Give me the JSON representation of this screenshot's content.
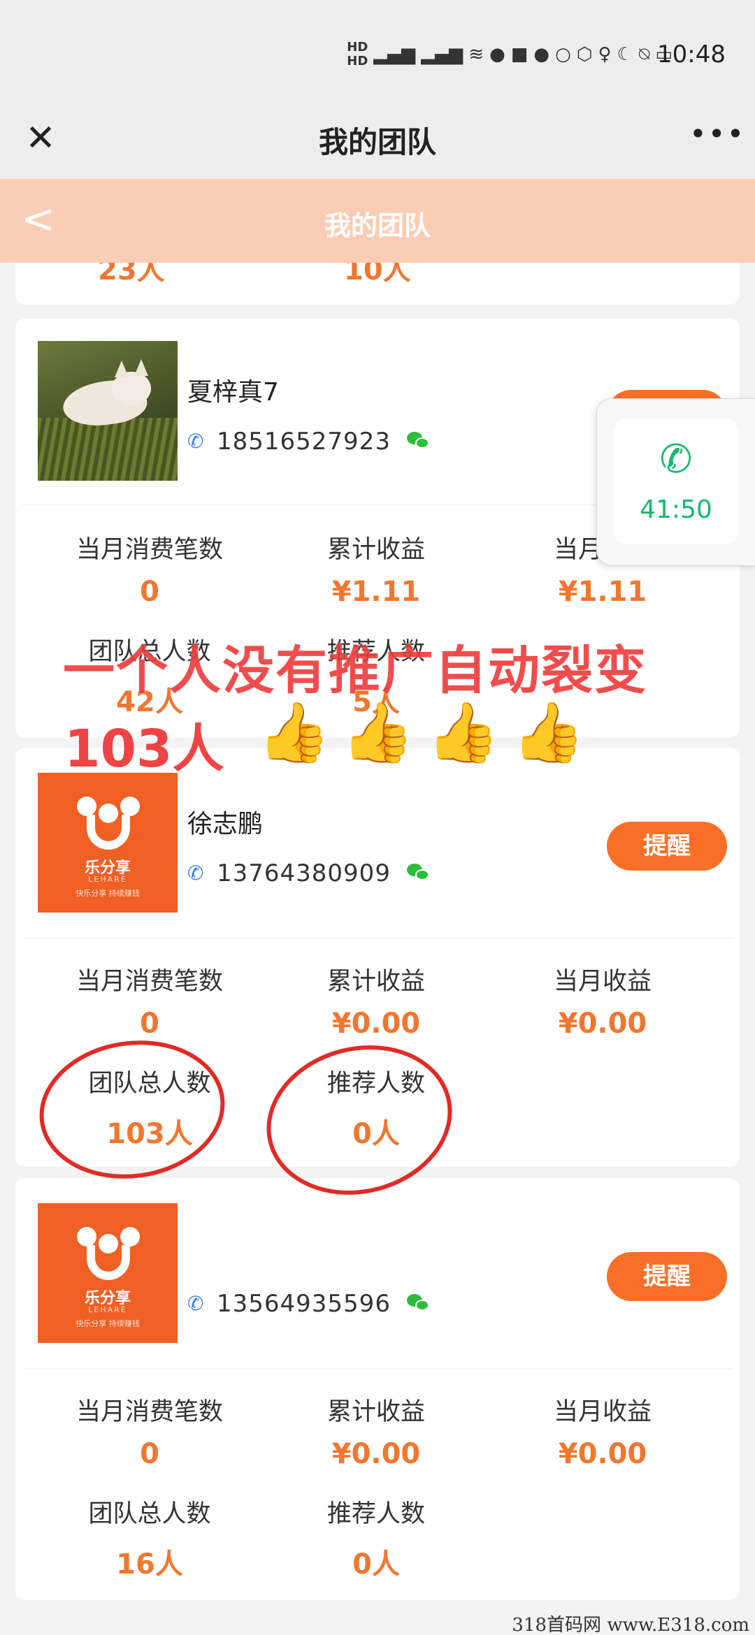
{
  "status_bar": {
    "time": "10:48",
    "indicators": [
      "HD",
      "5G",
      "4G",
      "wifi",
      "wechat",
      "huawei",
      "wechat",
      "chat",
      "shield",
      "mic",
      "moon",
      "mute",
      "battery"
    ]
  },
  "title_bar": {
    "title": "我的团队",
    "close_glyph": "✕",
    "more_glyph": "•••"
  },
  "page_header": {
    "title": "我的团队",
    "back_glyph": "<"
  },
  "partial_prev": {
    "team_total": "23人",
    "referrals": "10人"
  },
  "stat_labels": {
    "monthly_orders": "当月消费笔数",
    "total_income": "累计收益",
    "monthly_income": "当月收益",
    "team_total": "团队总人数",
    "referrals": "推荐人数"
  },
  "members": [
    {
      "name": "夏梓真7",
      "phone": "18516527923",
      "avatar": "cat-photo",
      "remind_label": "提醒",
      "monthly_orders": "0",
      "total_income": "¥1.11",
      "monthly_income": "¥1.11",
      "team_total": "42人",
      "referrals": "5人"
    },
    {
      "name": "徐志鹏",
      "phone": "13764380909",
      "avatar": "lefenxiang-logo",
      "remind_label": "提醒",
      "monthly_orders": "0",
      "total_income": "¥0.00",
      "monthly_income": "¥0.00",
      "team_total": "103人",
      "referrals": "0人"
    },
    {
      "name": "",
      "phone": "13564935596",
      "avatar": "lefenxiang-logo",
      "remind_label": "提醒",
      "monthly_orders": "0",
      "total_income": "¥0.00",
      "monthly_income": "¥0.00",
      "team_total": "16人",
      "referrals": "0人"
    }
  ],
  "logo": {
    "name": "乐分享",
    "sub": "LEHARE",
    "slogan": "快乐分享 持续赚钱"
  },
  "call_widget": {
    "icon": "phone-icon",
    "duration": "41:50"
  },
  "overlay": {
    "line1": "一个人没有推广自动裂变",
    "line2": "103人",
    "thumbs": "👍",
    "color": "#ee3a3a"
  },
  "watermark": "318首码网 www.E318.com",
  "colors": {
    "accent": "#f96f27",
    "value": "#f0772f",
    "header_bg": "#fbcdb5",
    "call_green": "#15b96c",
    "circle_red": "#e02b26"
  }
}
